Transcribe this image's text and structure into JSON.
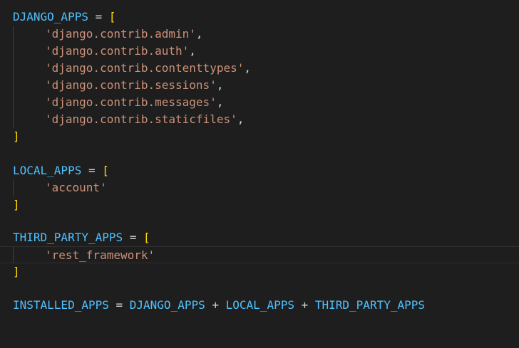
{
  "editor": {
    "lines": [
      {
        "tokens": [
          "DJANGO_APPS",
          " = ",
          "["
        ]
      },
      {
        "tokens": [
          "'django.contrib.admin'",
          ","
        ]
      },
      {
        "tokens": [
          "'django.contrib.auth'",
          ","
        ]
      },
      {
        "tokens": [
          "'django.contrib.contenttypes'",
          ","
        ]
      },
      {
        "tokens": [
          "'django.contrib.sessions'",
          ","
        ]
      },
      {
        "tokens": [
          "'django.contrib.messages'",
          ","
        ]
      },
      {
        "tokens": [
          "'django.contrib.staticfiles'",
          ","
        ]
      },
      {
        "tokens": [
          "]"
        ]
      },
      {
        "tokens": []
      },
      {
        "tokens": [
          "LOCAL_APPS",
          " = ",
          "["
        ]
      },
      {
        "tokens": [
          "'account'"
        ]
      },
      {
        "tokens": [
          "]"
        ]
      },
      {
        "tokens": []
      },
      {
        "tokens": [
          "THIRD_PARTY_APPS",
          " = ",
          "["
        ]
      },
      {
        "tokens": [
          "'rest_framework'"
        ]
      },
      {
        "tokens": [
          "]"
        ]
      },
      {
        "tokens": []
      },
      {
        "tokens": [
          "INSTALLED_APPS",
          " = ",
          "DJANGO_APPS",
          " + ",
          "LOCAL_APPS",
          " + ",
          "THIRD_PARTY_APPS"
        ]
      }
    ]
  },
  "colors": {
    "background": "#1e1e1e",
    "variable": "#4fc1ff",
    "operator": "#d4d4d4",
    "string": "#ce9178",
    "bracket": "#ffd700"
  }
}
